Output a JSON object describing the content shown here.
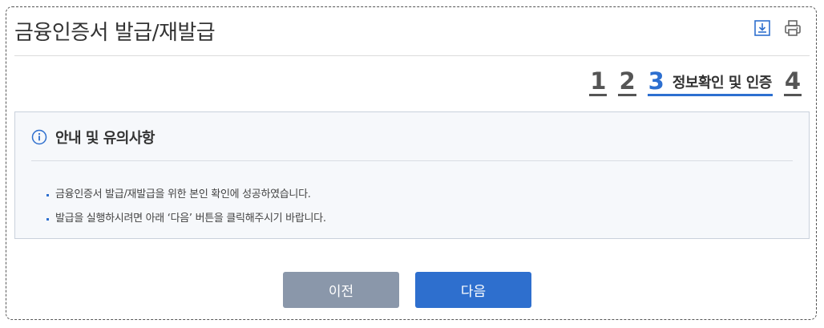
{
  "page": {
    "title": "금융인증서 발급/재발급"
  },
  "toolbar": {
    "icons": [
      "download-icon",
      "print-icon"
    ]
  },
  "steps": {
    "items": [
      "1",
      "2",
      "3",
      "4"
    ],
    "active_index": 2,
    "active_label": "정보확인 및 인증",
    "active_color": "#2d6fd0"
  },
  "notice": {
    "title": "안내 및 유의사항",
    "items": [
      "금융인증서 발급/재발급을 위한 본인 확인에 성공하였습니다.",
      "발급을 실행하시려면 아래 ‘다음’ 버튼을 클릭해주시기 바랍니다."
    ]
  },
  "buttons": {
    "prev_label": "이전",
    "next_label": "다음",
    "prev_color": "#8a97aa",
    "next_color": "#2e6fce"
  }
}
